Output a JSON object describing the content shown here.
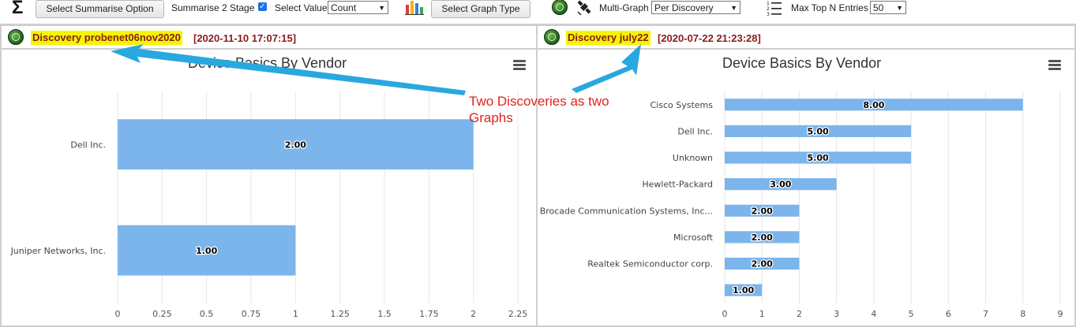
{
  "toolbar": {
    "sigma": "Σ",
    "summarise_button": "Select Summarise Option",
    "summarise_2_stage_label": "Summarise 2 Stage",
    "summarise_2_stage_checked": true,
    "select_value_label": "Select Value",
    "select_value_selected": "Count",
    "graph_type_button": "Select Graph Type",
    "multi_graph_label": "Multi-Graph",
    "multi_graph_selected": "Per Discovery",
    "max_top_label": "Max Top N Entries",
    "max_top_selected": "50",
    "icons": [
      "sigma-icon",
      "bar-chart-icon",
      "radar-icon",
      "satellite-icon",
      "numbered-list-icon"
    ]
  },
  "annotation": {
    "text": "Two Discoveries as two Graphs",
    "color": "#e3221c",
    "arrow_color": "#29a8e0"
  },
  "highlight_color": "#f5f500",
  "title_color": "#8b1a1a",
  "bar_color": "#7cb5ec",
  "panels": [
    {
      "discovery_name": "Discovery probenet06nov2020",
      "timestamp": "[2020-11-10 17:07:15]"
    },
    {
      "discovery_name": "Discovery july22",
      "timestamp": "[2020-07-22 21:23:28]"
    }
  ],
  "chart_data": [
    {
      "type": "bar",
      "orientation": "horizontal",
      "title": "Device Basics By Vendor",
      "categories": [
        "Dell Inc.",
        "Juniper Networks, Inc."
      ],
      "values": [
        2.0,
        1.0
      ],
      "value_labels": [
        "2.00",
        "1.00"
      ],
      "xlim": [
        0,
        2.25
      ],
      "xticks": [
        "0",
        "0.25",
        "0.5",
        "0.75",
        "1",
        "1.25",
        "1.5",
        "1.75",
        "2",
        "2.25"
      ],
      "grid": true,
      "legend": "none"
    },
    {
      "type": "bar",
      "orientation": "horizontal",
      "title": "Device Basics By Vendor",
      "categories": [
        "Cisco Systems",
        "Dell Inc.",
        "Unknown",
        "Hewlett-Packard",
        "Brocade Communication Systems, Inc...",
        "Microsoft",
        "Realtek Semiconductor corp.",
        ""
      ],
      "values": [
        8,
        5,
        5,
        3,
        2,
        2,
        2,
        1
      ],
      "value_labels": [
        "8.00",
        "5.00",
        "5.00",
        "3.00",
        "2.00",
        "2.00",
        "2.00",
        "1.00"
      ],
      "xlim": [
        0,
        9
      ],
      "xticks": [
        "0",
        "1",
        "2",
        "3",
        "4",
        "5",
        "6",
        "7",
        "8",
        "9"
      ],
      "grid": true,
      "legend": "none"
    }
  ]
}
